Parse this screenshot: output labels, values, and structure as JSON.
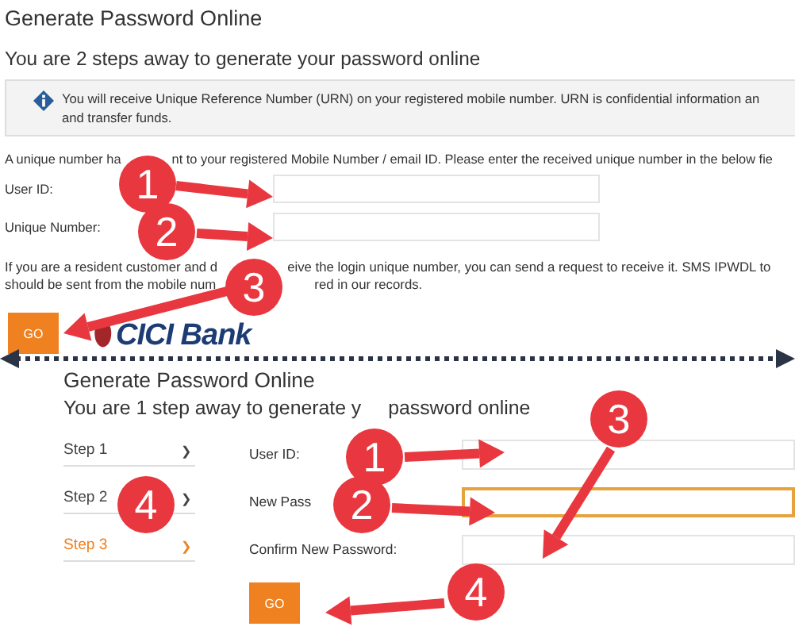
{
  "top": {
    "title": "Generate Password Online",
    "subtitle": "You are 2 steps away to generate your password online",
    "info": {
      "lines": [
        "You will receive Unique Reference Number (URN) on your registered mobile number. URN is confidential information an",
        "and transfer funds."
      ]
    },
    "notice": [
      "A unique number ha",
      "nt to your registered Mobile Number / email ID. Please enter the received unique number in the below fie"
    ],
    "fields": [
      {
        "label": "User ID:",
        "focused": false
      },
      {
        "label": "Unique Number:",
        "focused": false
      }
    ],
    "help_lines": [
      [
        "If you are a resident customer and d",
        "eive the login unique number, you can send a request to receive it. SMS IPWDL to"
      ],
      [
        "should be sent from the mobile num",
        "red in our records."
      ]
    ],
    "button": "GO",
    "logo": "CICI Bank"
  },
  "bottom": {
    "title": "Generate Password Online",
    "subtitle": [
      "You are 1 step away to generate y",
      "password online"
    ],
    "steps": [
      {
        "label": "Step 1",
        "arrow": "❯",
        "selected": false
      },
      {
        "label": "Step 2",
        "arrow": "❯",
        "selected": false
      },
      {
        "label": "Step 3",
        "arrow": "❯",
        "selected": true
      }
    ],
    "fields": [
      {
        "label": "User ID:",
        "focused": false
      },
      {
        "label": "New Pass",
        "focused": true
      },
      {
        "label": "Confirm New Password:",
        "focused": false
      }
    ],
    "button": "GO"
  },
  "annotations": [
    "1",
    "2",
    "3",
    "1",
    "2",
    "3",
    "4",
    "4"
  ]
}
